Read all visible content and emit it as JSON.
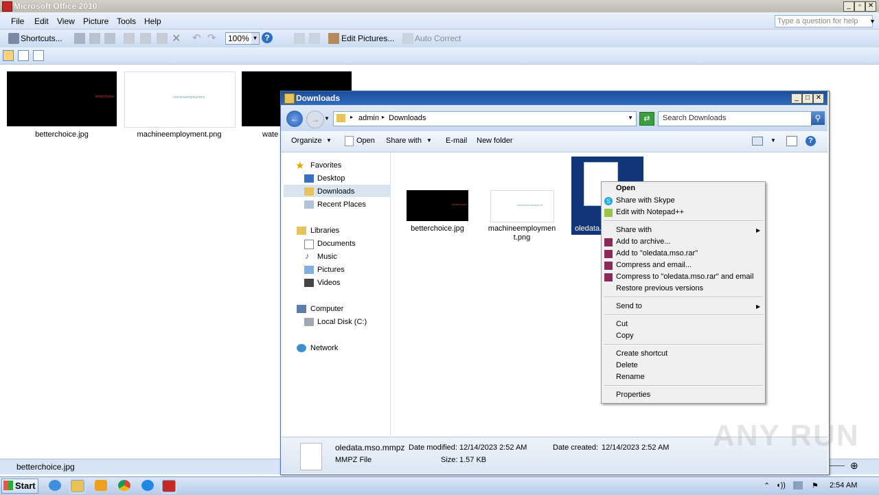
{
  "office": {
    "title": "Microsoft Office 2010",
    "menu": [
      "File",
      "Edit",
      "View",
      "Picture",
      "Tools",
      "Help"
    ],
    "ask_placeholder": "Type a question for help",
    "toolbar": {
      "shortcuts": "Shortcuts...",
      "zoom": "100%",
      "edit_pictures": "Edit Pictures...",
      "auto_correct": "Auto Correct"
    },
    "thumbnails": [
      {
        "label": "betterchoice.jpg",
        "caption": "betterchoice"
      },
      {
        "label": "machineemployment.png",
        "caption": "machineemployment"
      },
      {
        "label": "wate"
      }
    ],
    "status": "betterchoice.jpg"
  },
  "explorer": {
    "title": "Downloads",
    "breadcrumb": [
      "admin",
      "Downloads"
    ],
    "search_placeholder": "Search Downloads",
    "commands": [
      "Organize",
      "Open",
      "Share with",
      "E-mail",
      "New folder"
    ],
    "nav": {
      "favorites": "Favorites",
      "favorite_items": [
        "Desktop",
        "Downloads",
        "Recent Places"
      ],
      "libraries": "Libraries",
      "library_items": [
        "Documents",
        "Music",
        "Pictures",
        "Videos"
      ],
      "computer": "Computer",
      "computer_items": [
        "Local Disk (C:)"
      ],
      "network": "Network"
    },
    "files": [
      {
        "name": "betterchoice.jpg",
        "caption": "betterchoice"
      },
      {
        "name": "machineemploymen",
        "name2": "t.png",
        "caption": "machineemployment"
      },
      {
        "name": "oledata.m"
      }
    ],
    "details": {
      "filename": "oledata.mso.mmpz",
      "type": "MMPZ File",
      "date_modified_label": "Date modified:",
      "date_modified": "12/14/2023 2:52 AM",
      "size_label": "Size:",
      "size": "1.57 KB",
      "date_created_label": "Date created:",
      "date_created": "12/14/2023 2:52 AM"
    }
  },
  "context_menu": {
    "open": "Open",
    "skype": "Share with Skype",
    "notepad": "Edit with Notepad++",
    "share_with": "Share with",
    "add_archive": "Add to archive...",
    "add_rar": "Add to \"oledata.mso.rar\"",
    "compress_email": "Compress and email...",
    "compress_rar_email": "Compress to \"oledata.mso.rar\" and email",
    "restore": "Restore previous versions",
    "send_to": "Send to",
    "cut": "Cut",
    "copy": "Copy",
    "create_shortcut": "Create shortcut",
    "delete": "Delete",
    "rename": "Rename",
    "properties": "Properties"
  },
  "taskbar": {
    "start": "Start",
    "time": "2:54 AM"
  },
  "watermark": "ANY RUN"
}
